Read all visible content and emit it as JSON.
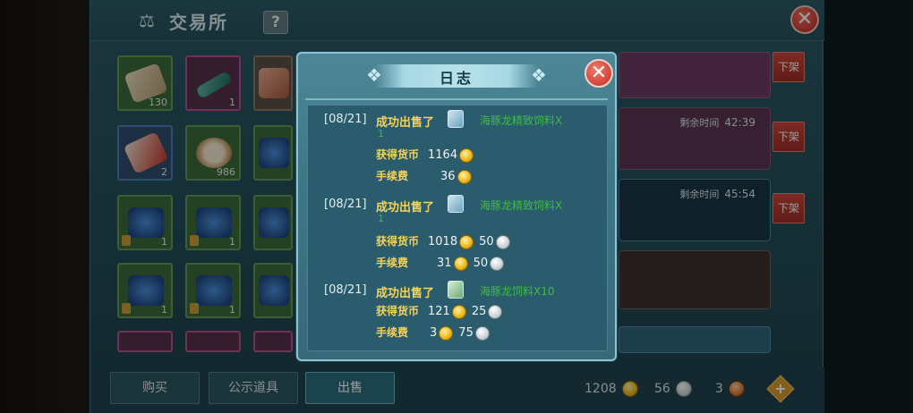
{
  "main": {
    "title": "交易所",
    "help_label": "?",
    "close_label": "✕"
  },
  "grid": {
    "items": [
      {
        "count": "130"
      },
      {
        "count": "1"
      },
      {
        "count": ""
      },
      {
        "count": "2"
      },
      {
        "count": "986"
      },
      {
        "count": ""
      },
      {
        "count": "1"
      },
      {
        "count": "1"
      },
      {
        "count": ""
      },
      {
        "count": "1"
      },
      {
        "count": "1"
      },
      {
        "count": ""
      }
    ]
  },
  "listings": [
    {
      "remaining_label": "",
      "remaining_time": ""
    },
    {
      "remaining_label": "剩余时间",
      "remaining_time": "42:39"
    },
    {
      "remaining_label": "剩余时间",
      "remaining_time": "45:54"
    }
  ],
  "off_shelf_label": "下架",
  "tabs": {
    "buy": "购买",
    "public": "公示道具",
    "sell": "出售"
  },
  "currency": {
    "gold": "1208",
    "silver": "56",
    "copper": "3",
    "add_label": "+"
  },
  "dialog": {
    "title": "日志",
    "close_label": "✕",
    "entries": [
      {
        "date": "[08/21]",
        "action": "成功出售了",
        "item_name": "海豚龙精致饲料X",
        "continuation": "1",
        "earned_label": "获得货币",
        "earned_gold": "1164",
        "earned_silver": "",
        "fee_label": "手续费",
        "fee_gold": "36",
        "fee_silver": ""
      },
      {
        "date": "[08/21]",
        "action": "成功出售了",
        "item_name": "海豚龙精致饲料X",
        "continuation": "1",
        "earned_label": "获得货币",
        "earned_gold": "1018",
        "earned_silver": "50",
        "fee_label": "手续费",
        "fee_gold": "31",
        "fee_silver": "50"
      },
      {
        "date": "[08/21]",
        "action": "成功出售了",
        "item_name": "海豚龙饲料X10",
        "continuation": "",
        "earned_label": "获得货币",
        "earned_gold": "121",
        "earned_silver": "25",
        "fee_label": "手续费",
        "fee_gold": "3",
        "fee_silver": "75"
      }
    ]
  }
}
